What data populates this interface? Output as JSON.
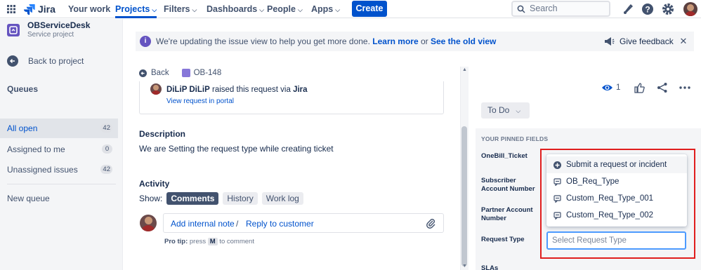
{
  "topnav": {
    "logo": "Jira",
    "items": [
      {
        "label": "Your work"
      },
      {
        "label": "Projects"
      },
      {
        "label": "Filters"
      },
      {
        "label": "Dashboards"
      },
      {
        "label": "People"
      },
      {
        "label": "Apps"
      }
    ],
    "create": "Create",
    "search_placeholder": "Search"
  },
  "sidebar": {
    "project_name": "OBServiceDesk",
    "project_type": "Service project",
    "back": "Back to project",
    "queues_heading": "Queues",
    "queues": [
      {
        "label": "All open",
        "count": "42"
      },
      {
        "label": "Assigned to me",
        "count": "0"
      },
      {
        "label": "Unassigned issues",
        "count": "42"
      }
    ],
    "new_queue": "New queue"
  },
  "banner": {
    "message": "We're updating the issue view to help you get more done.",
    "learn_more": "Learn more",
    "or": "or",
    "old_view": "See the old view",
    "feedback": "Give feedback"
  },
  "issue": {
    "back": "Back",
    "key": "OB-148",
    "reporter": "DiLiP DiLiP",
    "raised_text": "raised this request via",
    "channel": "Jira",
    "view_portal": "View request in portal",
    "description_heading": "Description",
    "description": "We are Setting the request type while creating ticket",
    "activity_heading": "Activity",
    "show_label": "Show:",
    "tabs": [
      {
        "label": "Comments"
      },
      {
        "label": "History"
      },
      {
        "label": "Work log"
      }
    ],
    "add_internal": "Add internal note",
    "slash": "/",
    "reply": "Reply to customer",
    "protip_prefix": "Pro tip:",
    "protip_press": "press",
    "protip_key": "M",
    "protip_suffix": "to comment"
  },
  "right": {
    "watchers": "1",
    "status": "To Do",
    "pinned_heading": "YOUR PINNED FIELDS",
    "fields": {
      "onebill": "OneBill_Ticket",
      "subscriber": "Subscriber Account Number",
      "partner": "Partner Account Number",
      "request_type": "Request Type",
      "slas": "SLAs"
    },
    "dropdown_options": [
      {
        "label": "Submit a request or incident"
      },
      {
        "label": "OB_Req_Type"
      },
      {
        "label": "Custom_Req_Type_001"
      },
      {
        "label": "Custom_Req_Type_002"
      }
    ],
    "request_type_placeholder": "Select Request Type"
  },
  "colors": {
    "brand": "#0052cc",
    "highlight": "#e01e1e",
    "focus": "#4c9aff"
  }
}
